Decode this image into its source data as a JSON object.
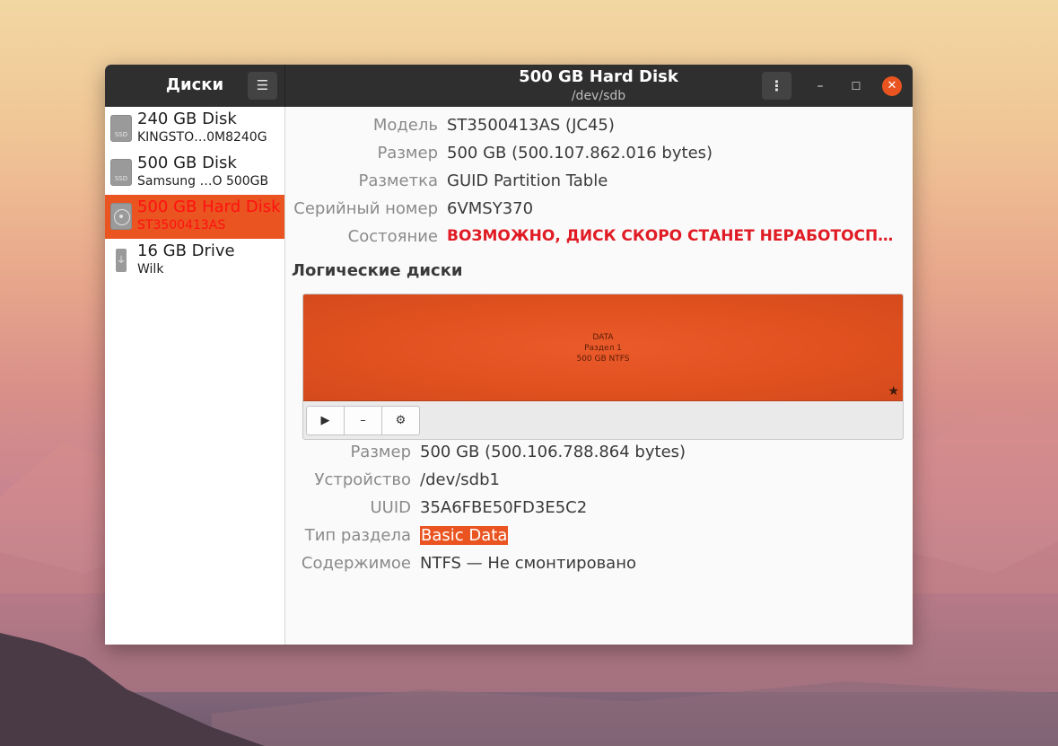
{
  "app": {
    "title": "Диски"
  },
  "header": {
    "title": "500 GB Hard Disk",
    "subtitle": "/dev/sdb"
  },
  "icons": {
    "menu": "hamburger-menu-icon",
    "kebab": "vertical-dots-icon",
    "minimize": "minimize-icon",
    "maximize": "maximize-icon",
    "close": "close-icon",
    "star": "star-icon",
    "play": "play-icon",
    "minus": "minus-icon",
    "gear": "gears-icon"
  },
  "colors": {
    "accent": "#e95420",
    "warning": "#e01b24",
    "titlebar": "#2f2f2f"
  },
  "sidebar": {
    "drives": [
      {
        "name": "240 GB Disk",
        "model": "KINGSTO…0M8240G",
        "icon_text": "SSD"
      },
      {
        "name": "500 GB Disk",
        "model": "Samsung …O 500GB",
        "icon_text": "SSD"
      },
      {
        "name": "500 GB Hard Disk",
        "model": "ST3500413AS"
      },
      {
        "name": "16 GB Drive",
        "model": "Wilk"
      }
    ]
  },
  "disk": {
    "model_label": "Модель",
    "model_value": "ST3500413AS (JC45)",
    "size_label": "Размер",
    "size_value": "500 GB (500.107.862.016 bytes)",
    "partitioning_label": "Разметка",
    "partitioning_value": "GUID Partition Table",
    "serial_label": "Серийный номер",
    "serial_value": "6VMSY370",
    "status_label": "Состояние",
    "status_value": "ВОЗМОЖНО, ДИСК СКОРО СТАНЕТ НЕРАБОТОСП…"
  },
  "volumes": {
    "title": "Логические диски",
    "partition": {
      "line1": "DATA",
      "line2": "Раздел 1",
      "line3": "500 GB NTFS"
    },
    "buttons": {
      "play": "▶",
      "minus": "–",
      "gear": "⚙"
    }
  },
  "partition_info": {
    "size_label": "Размер",
    "size_value": "500 GB (500.106.788.864 bytes)",
    "device_label": "Устройство",
    "device_value": "/dev/sdb1",
    "uuid_label": "UUID",
    "uuid_value": "35A6FBE50FD3E5C2",
    "type_label": "Тип раздела",
    "type_value": "Basic Data",
    "contents_label": "Содержимое",
    "contents_value": "NTFS — Не смонтировано"
  }
}
